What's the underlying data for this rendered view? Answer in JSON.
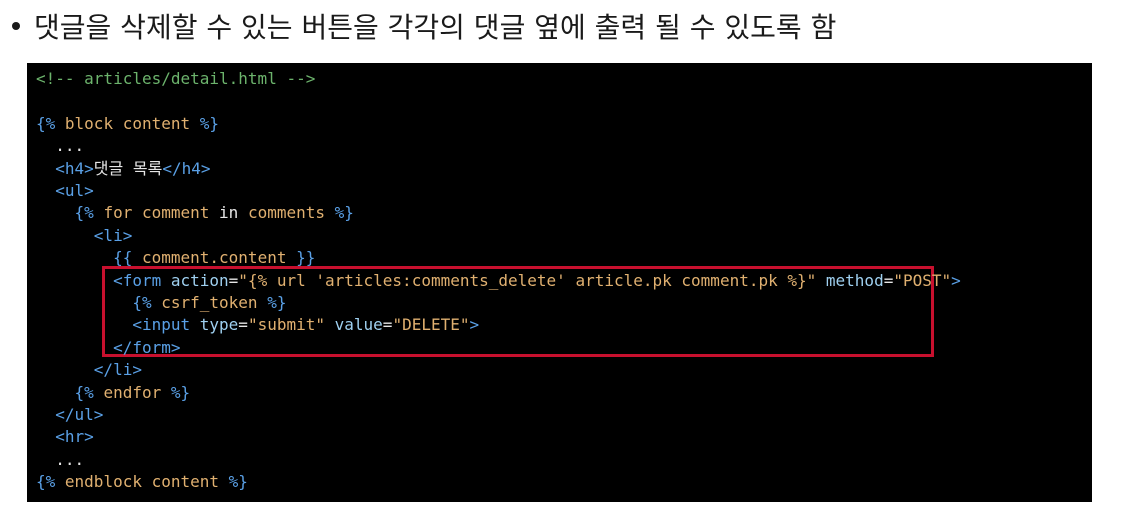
{
  "heading": {
    "text": "댓글을 삭제할 수 있는 버튼을 각각의 댓글 옆에 출력 될 수 있도록 함"
  },
  "code": {
    "lines": [
      {
        "indent": "",
        "parts": [
          {
            "t": "<!-- articles/detail.html -->",
            "c": "c-comment"
          }
        ]
      },
      {
        "indent": "",
        "parts": []
      },
      {
        "indent": "",
        "parts": [
          {
            "t": "{% ",
            "c": "c-tmpl"
          },
          {
            "t": "block",
            "c": "c-str"
          },
          {
            "t": " content ",
            "c": "c-str"
          },
          {
            "t": "%}",
            "c": "c-tmpl"
          }
        ]
      },
      {
        "indent": "  ",
        "parts": [
          {
            "t": "...",
            "c": "c-text"
          }
        ]
      },
      {
        "indent": "  ",
        "parts": [
          {
            "t": "<h4>",
            "c": "c-tag"
          },
          {
            "t": "댓글 목록",
            "c": "c-text"
          },
          {
            "t": "</h4>",
            "c": "c-tag"
          }
        ]
      },
      {
        "indent": "  ",
        "parts": [
          {
            "t": "<ul>",
            "c": "c-tag"
          }
        ]
      },
      {
        "indent": "    ",
        "parts": [
          {
            "t": "{% ",
            "c": "c-tmpl"
          },
          {
            "t": "for",
            "c": "c-str"
          },
          {
            "t": " comment ",
            "c": "c-str"
          },
          {
            "t": "in",
            "c": "c-text"
          },
          {
            "t": " comments ",
            "c": "c-str"
          },
          {
            "t": "%}",
            "c": "c-tmpl"
          }
        ]
      },
      {
        "indent": "      ",
        "parts": [
          {
            "t": "<li>",
            "c": "c-tag"
          }
        ]
      },
      {
        "indent": "        ",
        "parts": [
          {
            "t": "{{ ",
            "c": "c-tmpl"
          },
          {
            "t": "comment.content",
            "c": "c-str"
          },
          {
            "t": " }}",
            "c": "c-tmpl"
          }
        ]
      },
      {
        "indent": "        ",
        "parts": [
          {
            "t": "<form ",
            "c": "c-tag"
          },
          {
            "t": "action",
            "c": "c-attr"
          },
          {
            "t": "=",
            "c": "c-text"
          },
          {
            "t": "\"{% url 'articles:comments_delete' article.pk comment.pk %}\"",
            "c": "c-str"
          },
          {
            "t": " method",
            "c": "c-attr"
          },
          {
            "t": "=",
            "c": "c-text"
          },
          {
            "t": "\"POST\"",
            "c": "c-str"
          },
          {
            "t": ">",
            "c": "c-tag"
          }
        ]
      },
      {
        "indent": "          ",
        "parts": [
          {
            "t": "{% ",
            "c": "c-tmpl"
          },
          {
            "t": "csrf_token",
            "c": "c-str"
          },
          {
            "t": " %}",
            "c": "c-tmpl"
          }
        ]
      },
      {
        "indent": "          ",
        "parts": [
          {
            "t": "<input ",
            "c": "c-tag"
          },
          {
            "t": "type",
            "c": "c-attr"
          },
          {
            "t": "=",
            "c": "c-text"
          },
          {
            "t": "\"submit\"",
            "c": "c-str"
          },
          {
            "t": " value",
            "c": "c-attr"
          },
          {
            "t": "=",
            "c": "c-text"
          },
          {
            "t": "\"DELETE\"",
            "c": "c-str"
          },
          {
            "t": ">",
            "c": "c-tag"
          }
        ]
      },
      {
        "indent": "        ",
        "parts": [
          {
            "t": "</form>",
            "c": "c-tag"
          }
        ]
      },
      {
        "indent": "      ",
        "parts": [
          {
            "t": "</li>",
            "c": "c-tag"
          }
        ]
      },
      {
        "indent": "    ",
        "parts": [
          {
            "t": "{% ",
            "c": "c-tmpl"
          },
          {
            "t": "endfor",
            "c": "c-str"
          },
          {
            "t": " %}",
            "c": "c-tmpl"
          }
        ]
      },
      {
        "indent": "  ",
        "parts": [
          {
            "t": "</ul>",
            "c": "c-tag"
          }
        ]
      },
      {
        "indent": "  ",
        "parts": [
          {
            "t": "<hr>",
            "c": "c-tag"
          }
        ]
      },
      {
        "indent": "  ",
        "parts": [
          {
            "t": "...",
            "c": "c-text"
          }
        ]
      },
      {
        "indent": "",
        "parts": [
          {
            "t": "{% ",
            "c": "c-tmpl"
          },
          {
            "t": "endblock",
            "c": "c-str"
          },
          {
            "t": " content ",
            "c": "c-str"
          },
          {
            "t": "%}",
            "c": "c-tmpl"
          }
        ]
      }
    ]
  },
  "highlight": {
    "color": "#c8102e",
    "label": "form-block"
  },
  "colors": {
    "panel_bg": "#000000",
    "comment": "#6cb36c",
    "template": "#5aa0e6",
    "string": "#e0b070",
    "text": "#e6e6e6"
  }
}
